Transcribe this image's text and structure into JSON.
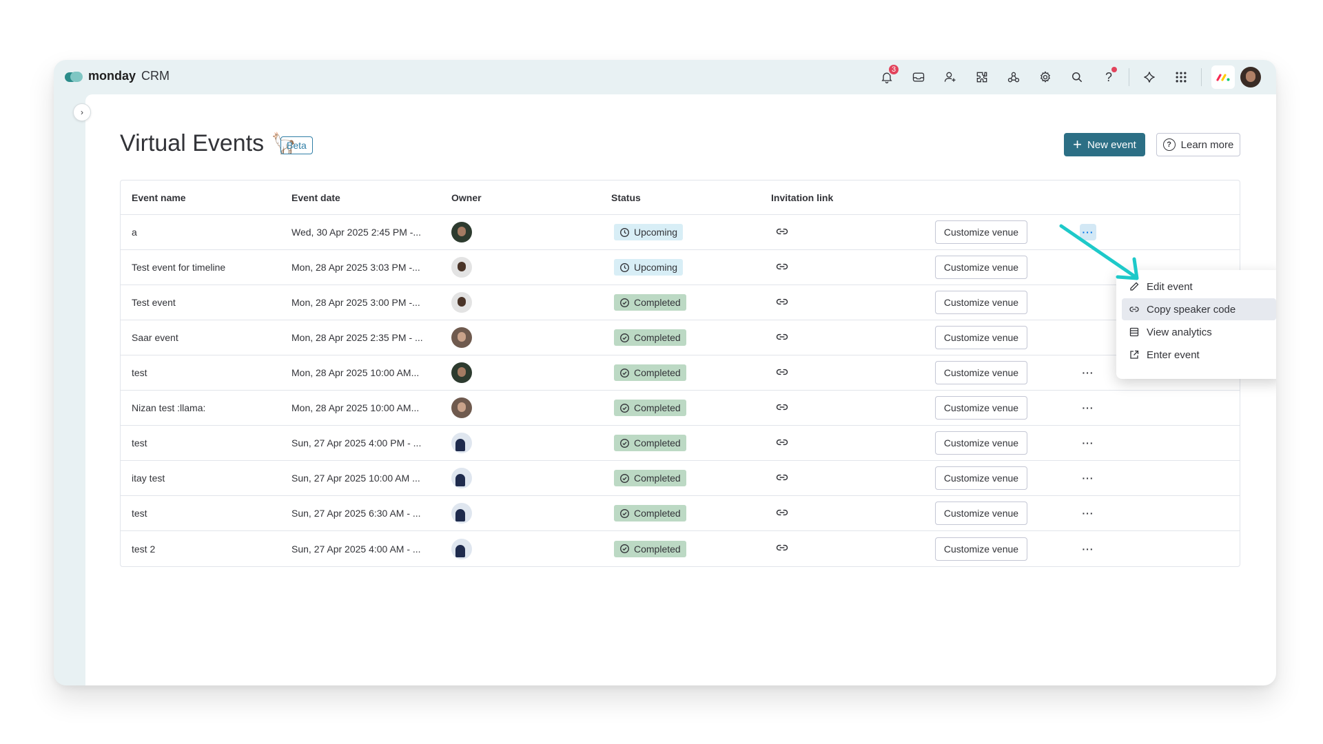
{
  "app": {
    "brand_name": "monday",
    "brand_product": "CRM",
    "notification_count": "3"
  },
  "topbar_icons": [
    "bell-icon",
    "inbox-icon",
    "invite-members-icon",
    "apps-icon",
    "integrations-icon",
    "settings-icon",
    "search-icon",
    "help-icon",
    "ai-sparkle-icon",
    "app-switcher-icon",
    "monday-logo-icon",
    "user-avatar"
  ],
  "page": {
    "title": "Virtual Events",
    "emoji": "🦙",
    "badge": "Beta",
    "new_event_label": "New event",
    "learn_more_label": "Learn more"
  },
  "table": {
    "columns": [
      "Event name",
      "Event date",
      "Owner",
      "Status",
      "Invitation link"
    ],
    "customize_label": "Customize venue",
    "rows": [
      {
        "name": "a",
        "date": "Wed, 30 Apr 2025 2:45 PM -...",
        "owner_avatar": "a",
        "status": "Upcoming"
      },
      {
        "name": "Test event for timeline",
        "date": "Mon, 28 Apr 2025 3:03 PM -...",
        "owner_avatar": "b",
        "status": "Upcoming"
      },
      {
        "name": "Test event",
        "date": "Mon, 28 Apr 2025 3:00 PM -...",
        "owner_avatar": "b",
        "status": "Completed"
      },
      {
        "name": "Saar event",
        "date": "Mon, 28 Apr 2025 2:35 PM - ...",
        "owner_avatar": "c",
        "status": "Completed"
      },
      {
        "name": "test",
        "date": "Mon, 28 Apr 2025 10:00 AM...",
        "owner_avatar": "a",
        "status": "Completed"
      },
      {
        "name": "Nizan test :llama:",
        "date": "Mon, 28 Apr 2025 10:00 AM...",
        "owner_avatar": "c",
        "status": "Completed"
      },
      {
        "name": "test",
        "date": "Sun, 27 Apr 2025 4:00 PM - ...",
        "owner_avatar": "d",
        "status": "Completed"
      },
      {
        "name": "itay test",
        "date": "Sun, 27 Apr 2025 10:00 AM ...",
        "owner_avatar": "d",
        "status": "Completed"
      },
      {
        "name": "test",
        "date": "Sun, 27 Apr 2025 6:30 AM - ...",
        "owner_avatar": "d",
        "status": "Completed"
      },
      {
        "name": "test 2",
        "date": "Sun, 27 Apr 2025 4:00 AM - ...",
        "owner_avatar": "d",
        "status": "Completed"
      }
    ]
  },
  "context_menu": {
    "items": [
      {
        "label": "Edit event",
        "icon": "pencil-icon"
      },
      {
        "label": "Copy speaker code",
        "icon": "link-icon"
      },
      {
        "label": "View analytics",
        "icon": "table-icon"
      },
      {
        "label": "Enter event",
        "icon": "external-link-icon"
      }
    ],
    "hovered_index": 1
  },
  "colors": {
    "primary": "#2c6f85",
    "upcoming_bg": "#d8eef6",
    "completed_bg": "#bcd9c4",
    "annotation_arrow": "#1ec9c9",
    "notification": "#e2445c"
  }
}
